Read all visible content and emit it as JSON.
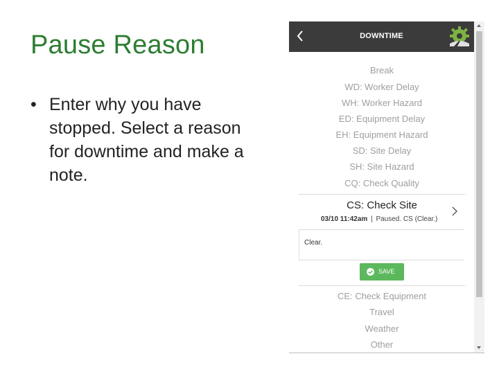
{
  "slide": {
    "title": "Pause Reason",
    "bullet": "•",
    "bullet_text": "Enter why you have stopped. Select a reason for downtime and make a note."
  },
  "app": {
    "header": {
      "title": "DOWNTIME",
      "back_icon": "chevron-left-icon",
      "logo_icon": "gear-logo-icon"
    },
    "reasons_above": [
      "Break",
      "WD: Worker Delay",
      "WH: Worker Hazard",
      "ED: Equipment Delay",
      "EH: Equipment Hazard",
      "SD: Site Delay",
      "SH: Site Hazard",
      "CQ: Check Quality"
    ],
    "selected": {
      "label": "CS: Check Site",
      "timestamp": "03/10 11:42am",
      "separator": "|",
      "status": "Paused. CS (Clear.)",
      "note": "Clear.",
      "save_label": "SAVE"
    },
    "reasons_below": [
      "CE: Check Equipment",
      "Travel",
      "Weather",
      "Other"
    ],
    "colors": {
      "header_bg": "#3b3b3b",
      "save_green": "#5cb85c",
      "title_green": "#2e7d32"
    }
  }
}
